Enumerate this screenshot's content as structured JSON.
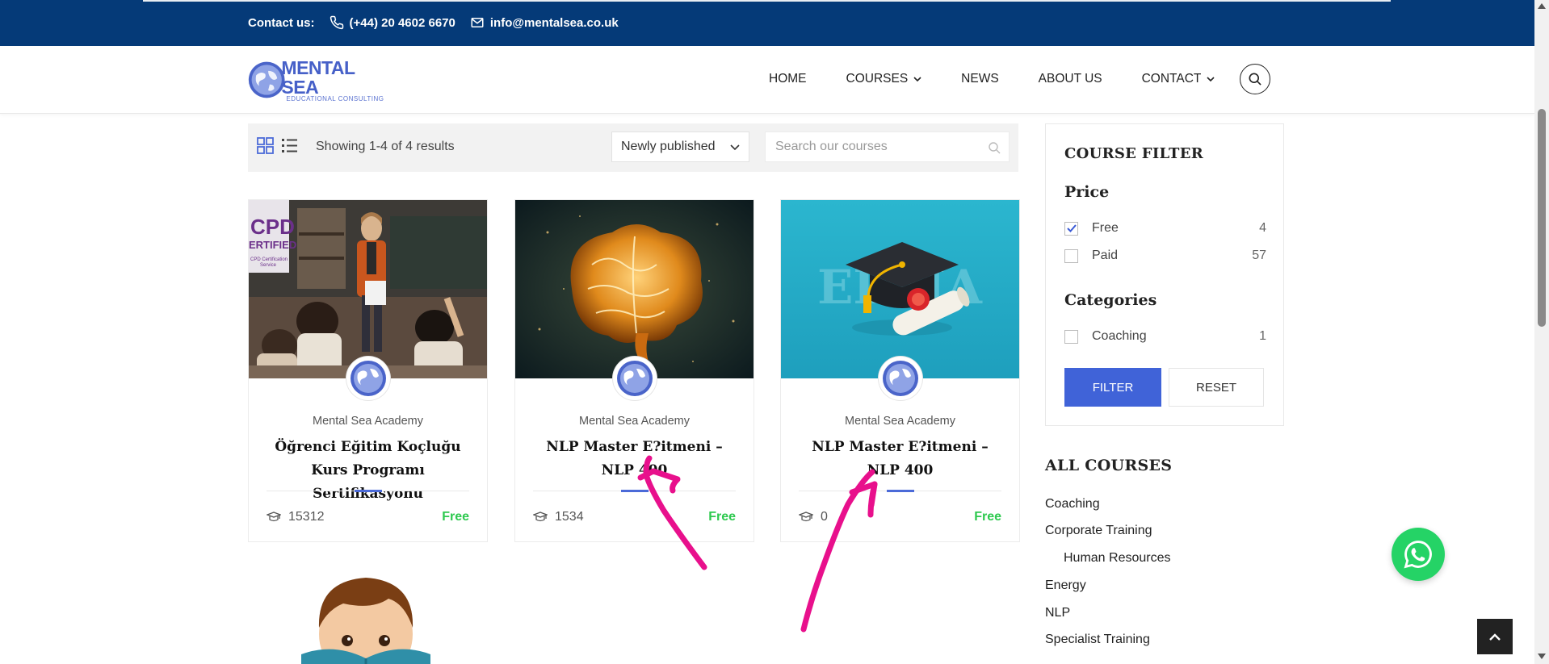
{
  "topbar": {
    "contact_label": "Contact us:",
    "phone": "(+44) 20 4602 6670",
    "email": "info@mentalsea.co.uk"
  },
  "logo": {
    "name": "MENTAL SEA",
    "tagline": "EDUCATIONAL CONSULTING"
  },
  "nav": {
    "items": [
      {
        "label": "HOME",
        "has_dropdown": false
      },
      {
        "label": "COURSES",
        "has_dropdown": true
      },
      {
        "label": "NEWS",
        "has_dropdown": false
      },
      {
        "label": "ABOUT US",
        "has_dropdown": false
      },
      {
        "label": "CONTACT",
        "has_dropdown": true
      }
    ],
    "search_icon": "search-icon"
  },
  "toolbar": {
    "showing": "Showing 1-4 of 4 results",
    "sort_value": "Newly published",
    "search_placeholder": "Search our courses"
  },
  "courses": [
    {
      "author": "Mental Sea Academy",
      "title": "Öğrenci Eğitim Koçluğu Kurs Programı Sertifikasyonu",
      "students": "15312",
      "price": "Free",
      "thumb_text": "CPD ERTIFIED",
      "thumb_sub": "CPD Certification Service"
    },
    {
      "author": "Mental Sea Academy",
      "title": "NLP Master E?itmeni – NLP 400",
      "students": "1534",
      "price": "Free"
    },
    {
      "author": "Mental Sea Academy",
      "title": "NLP Master E?itmeni – NLP 400",
      "students": "0",
      "price": "Free",
      "thumb_text": "EDMA"
    }
  ],
  "filter": {
    "title": "COURSE FILTER",
    "price_heading": "Price",
    "price_options": [
      {
        "label": "Free",
        "count": "4",
        "checked": true
      },
      {
        "label": "Paid",
        "count": "57",
        "checked": false
      }
    ],
    "categories_heading": "Categories",
    "category_options": [
      {
        "label": "Coaching",
        "count": "1",
        "checked": false
      }
    ],
    "filter_button": "FILTER",
    "reset_button": "RESET"
  },
  "all_courses": {
    "title": "ALL COURSES",
    "items": [
      {
        "label": "Coaching",
        "indent": false
      },
      {
        "label": "Corporate Training",
        "indent": false
      },
      {
        "label": "Human Resources",
        "indent": true
      },
      {
        "label": "Energy",
        "indent": false
      },
      {
        "label": "NLP",
        "indent": false
      },
      {
        "label": "Specialist Training",
        "indent": false
      }
    ]
  },
  "colors": {
    "topbar": "#053a78",
    "accent": "#4063d8",
    "price_free": "#2ec94f",
    "annotation": "#e8108c",
    "whatsapp": "#25d366"
  }
}
